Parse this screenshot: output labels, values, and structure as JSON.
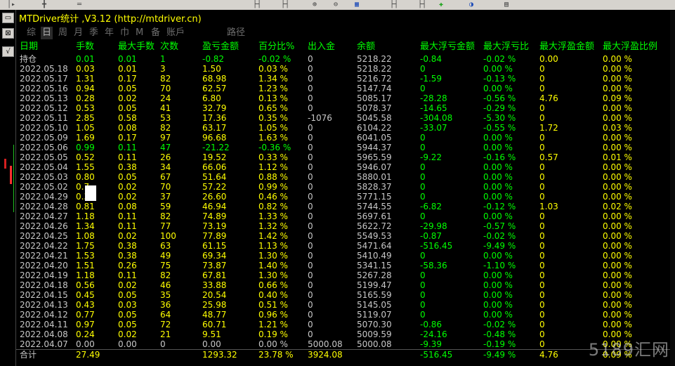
{
  "toolbar": {
    "icons": [
      "cursor-icon",
      "crosshair-icon",
      "hline-icon",
      "zoom-in-icon",
      "zoom-out-icon",
      "grid-icon",
      "period-icon",
      "chart-add-icon",
      "refresh-icon",
      "template-icon"
    ]
  },
  "left_strip": [
    "chart-icon",
    "collapse-icon",
    "check-icon"
  ],
  "window": {
    "title": "MTDriver统计 ,V3.12 (http://mtdriver.cn)"
  },
  "tabs": [
    "综",
    "日",
    "周",
    "月",
    "季",
    "年",
    "巾",
    "M",
    "备",
    "账戶",
    "路径"
  ],
  "active_tab": "日",
  "columns": [
    "日期",
    "手数",
    "最大手数",
    "次数",
    "盈亏金额",
    "百分比%",
    "出入金",
    "余额",
    "最大浮亏金额",
    "最大浮亏比",
    "最大浮盈金额",
    "最大浮盈比例"
  ],
  "rows": [
    {
      "date": "持仓",
      "lots": "0.01",
      "maxlots": "0.01",
      "count": "1",
      "pnl": "-0.82",
      "pct": "-0.02 %",
      "io": "0",
      "bal": "5218.22",
      "mfl": "-0.84",
      "mflr": "-0.02 %",
      "mfp": "0.00",
      "mfpr": "0.00 %",
      "tone": "green"
    },
    {
      "date": "2022.05.18",
      "lots": "0.03",
      "maxlots": "0.01",
      "count": "3",
      "pnl": "1.50",
      "pct": "0.03 %",
      "io": "0",
      "bal": "5218.22",
      "mfl": "0",
      "mflr": "0.00 %",
      "mfp": "0",
      "mfpr": "0.00 %",
      "tone": "yellow"
    },
    {
      "date": "2022.05.17",
      "lots": "1.31",
      "maxlots": "0.17",
      "count": "82",
      "pnl": "68.98",
      "pct": "1.34 %",
      "io": "0",
      "bal": "5216.72",
      "mfl": "-1.59",
      "mflr": "-0.13 %",
      "mfp": "0",
      "mfpr": "0.00 %",
      "tone": "yellow"
    },
    {
      "date": "2022.05.16",
      "lots": "0.94",
      "maxlots": "0.05",
      "count": "70",
      "pnl": "62.57",
      "pct": "1.23 %",
      "io": "0",
      "bal": "5147.74",
      "mfl": "0",
      "mflr": "0.00 %",
      "mfp": "0",
      "mfpr": "0.00 %",
      "tone": "yellow"
    },
    {
      "date": "2022.05.13",
      "lots": "0.28",
      "maxlots": "0.02",
      "count": "24",
      "pnl": "6.80",
      "pct": "0.13 %",
      "io": "0",
      "bal": "5085.17",
      "mfl": "-28.28",
      "mflr": "-0.56 %",
      "mfp": "4.76",
      "mfpr": "0.09 %",
      "tone": "yellow"
    },
    {
      "date": "2022.05.12",
      "lots": "0.53",
      "maxlots": "0.05",
      "count": "41",
      "pnl": "32.79",
      "pct": "0.65 %",
      "io": "0",
      "bal": "5078.37",
      "mfl": "-14.65",
      "mflr": "-0.29 %",
      "mfp": "0",
      "mfpr": "0.00 %",
      "tone": "yellow"
    },
    {
      "date": "2022.05.11",
      "lots": "2.85",
      "maxlots": "0.58",
      "count": "53",
      "pnl": "17.36",
      "pct": "0.35 %",
      "io": "-1076",
      "bal": "5045.58",
      "mfl": "-304.08",
      "mflr": "-5.30 %",
      "mfp": "0",
      "mfpr": "0.00 %",
      "tone": "yellow"
    },
    {
      "date": "2022.05.10",
      "lots": "1.05",
      "maxlots": "0.08",
      "count": "82",
      "pnl": "63.17",
      "pct": "1.05 %",
      "io": "0",
      "bal": "6104.22",
      "mfl": "-33.07",
      "mflr": "-0.55 %",
      "mfp": "1.72",
      "mfpr": "0.03 %",
      "tone": "yellow"
    },
    {
      "date": "2022.05.09",
      "lots": "1.69",
      "maxlots": "0.17",
      "count": "97",
      "pnl": "96.68",
      "pct": "1.63 %",
      "io": "0",
      "bal": "6041.05",
      "mfl": "0",
      "mflr": "0.00 %",
      "mfp": "0",
      "mfpr": "0.00 %",
      "tone": "yellow"
    },
    {
      "date": "2022.05.06",
      "lots": "0.99",
      "maxlots": "0.11",
      "count": "47",
      "pnl": "-21.22",
      "pct": "-0.36 %",
      "io": "0",
      "bal": "5944.37",
      "mfl": "0",
      "mflr": "0.00 %",
      "mfp": "0",
      "mfpr": "0.00 %",
      "tone": "green"
    },
    {
      "date": "2022.05.05",
      "lots": "0.52",
      "maxlots": "0.11",
      "count": "26",
      "pnl": "19.52",
      "pct": "0.33 %",
      "io": "0",
      "bal": "5965.59",
      "mfl": "-9.22",
      "mflr": "-0.16 %",
      "mfp": "0.57",
      "mfpr": "0.01 %",
      "tone": "yellow"
    },
    {
      "date": "2022.05.04",
      "lots": "1.55",
      "maxlots": "0.38",
      "count": "34",
      "pnl": "66.06",
      "pct": "1.12 %",
      "io": "0",
      "bal": "5946.07",
      "mfl": "0",
      "mflr": "0.00 %",
      "mfp": "0",
      "mfpr": "0.00 %",
      "tone": "yellow"
    },
    {
      "date": "2022.05.03",
      "lots": "0.80",
      "maxlots": "0.05",
      "count": "67",
      "pnl": "51.64",
      "pct": "0.88 %",
      "io": "0",
      "bal": "5880.01",
      "mfl": "0",
      "mflr": "0.00 %",
      "mfp": "0",
      "mfpr": "0.00 %",
      "tone": "yellow"
    },
    {
      "date": "2022.05.02",
      "lots": "0.7",
      "maxlots": "0.02",
      "count": "70",
      "pnl": "57.22",
      "pct": "0.99 %",
      "io": "0",
      "bal": "5828.37",
      "mfl": "0",
      "mflr": "0.00 %",
      "mfp": "0",
      "mfpr": "0.00 %",
      "tone": "yellow"
    },
    {
      "date": "2022.04.29",
      "lots": "0.3",
      "maxlots": "0.02",
      "count": "37",
      "pnl": "26.60",
      "pct": "0.46 %",
      "io": "0",
      "bal": "5771.15",
      "mfl": "0",
      "mflr": "0.00 %",
      "mfp": "0",
      "mfpr": "0.00 %",
      "tone": "yellow"
    },
    {
      "date": "2022.04.28",
      "lots": "0.81",
      "maxlots": "0.08",
      "count": "59",
      "pnl": "46.94",
      "pct": "0.82 %",
      "io": "0",
      "bal": "5744.55",
      "mfl": "-6.82",
      "mflr": "-0.12 %",
      "mfp": "1.03",
      "mfpr": "0.02 %",
      "tone": "yellow"
    },
    {
      "date": "2022.04.27",
      "lots": "1.18",
      "maxlots": "0.11",
      "count": "82",
      "pnl": "74.89",
      "pct": "1.33 %",
      "io": "0",
      "bal": "5697.61",
      "mfl": "0",
      "mflr": "0.00 %",
      "mfp": "0",
      "mfpr": "0.00 %",
      "tone": "yellow"
    },
    {
      "date": "2022.04.26",
      "lots": "1.34",
      "maxlots": "0.11",
      "count": "77",
      "pnl": "73.19",
      "pct": "1.32 %",
      "io": "0",
      "bal": "5622.72",
      "mfl": "-29.98",
      "mflr": "-0.57 %",
      "mfp": "0",
      "mfpr": "0.00 %",
      "tone": "yellow"
    },
    {
      "date": "2022.04.25",
      "lots": "1.08",
      "maxlots": "0.02",
      "count": "100",
      "pnl": "77.89",
      "pct": "1.42 %",
      "io": "0",
      "bal": "5549.53",
      "mfl": "-0.87",
      "mflr": "-0.02 %",
      "mfp": "0",
      "mfpr": "0.00 %",
      "tone": "yellow"
    },
    {
      "date": "2022.04.22",
      "lots": "1.75",
      "maxlots": "0.38",
      "count": "63",
      "pnl": "61.15",
      "pct": "1.13 %",
      "io": "0",
      "bal": "5471.64",
      "mfl": "-516.45",
      "mflr": "-9.49 %",
      "mfp": "0",
      "mfpr": "0.00 %",
      "tone": "yellow"
    },
    {
      "date": "2022.04.21",
      "lots": "1.53",
      "maxlots": "0.38",
      "count": "49",
      "pnl": "69.34",
      "pct": "1.30 %",
      "io": "0",
      "bal": "5410.49",
      "mfl": "0",
      "mflr": "0.00 %",
      "mfp": "0",
      "mfpr": "0.00 %",
      "tone": "yellow"
    },
    {
      "date": "2022.04.20",
      "lots": "1.51",
      "maxlots": "0.26",
      "count": "75",
      "pnl": "73.87",
      "pct": "1.40 %",
      "io": "0",
      "bal": "5341.15",
      "mfl": "-58.36",
      "mflr": "-1.10 %",
      "mfp": "0",
      "mfpr": "0.00 %",
      "tone": "yellow"
    },
    {
      "date": "2022.04.19",
      "lots": "1.18",
      "maxlots": "0.11",
      "count": "82",
      "pnl": "67.81",
      "pct": "1.30 %",
      "io": "0",
      "bal": "5267.28",
      "mfl": "0",
      "mflr": "0.00 %",
      "mfp": "0",
      "mfpr": "0.00 %",
      "tone": "yellow"
    },
    {
      "date": "2022.04.18",
      "lots": "0.56",
      "maxlots": "0.02",
      "count": "46",
      "pnl": "33.88",
      "pct": "0.66 %",
      "io": "0",
      "bal": "5199.47",
      "mfl": "0",
      "mflr": "0.00 %",
      "mfp": "0",
      "mfpr": "0.00 %",
      "tone": "yellow"
    },
    {
      "date": "2022.04.15",
      "lots": "0.45",
      "maxlots": "0.05",
      "count": "35",
      "pnl": "20.54",
      "pct": "0.40 %",
      "io": "0",
      "bal": "5165.59",
      "mfl": "0",
      "mflr": "0.00 %",
      "mfp": "0",
      "mfpr": "0.00 %",
      "tone": "yellow"
    },
    {
      "date": "2022.04.13",
      "lots": "0.43",
      "maxlots": "0.03",
      "count": "36",
      "pnl": "25.98",
      "pct": "0.51 %",
      "io": "0",
      "bal": "5145.05",
      "mfl": "0",
      "mflr": "0.00 %",
      "mfp": "0",
      "mfpr": "0.00 %",
      "tone": "yellow"
    },
    {
      "date": "2022.04.12",
      "lots": "0.77",
      "maxlots": "0.05",
      "count": "64",
      "pnl": "48.77",
      "pct": "0.96 %",
      "io": "0",
      "bal": "5119.07",
      "mfl": "0",
      "mflr": "0.00 %",
      "mfp": "0",
      "mfpr": "0.00 %",
      "tone": "yellow"
    },
    {
      "date": "2022.04.11",
      "lots": "0.97",
      "maxlots": "0.05",
      "count": "72",
      "pnl": "60.71",
      "pct": "1.21 %",
      "io": "0",
      "bal": "5070.30",
      "mfl": "-0.86",
      "mflr": "-0.02 %",
      "mfp": "0",
      "mfpr": "0.00 %",
      "tone": "yellow"
    },
    {
      "date": "2022.04.08",
      "lots": "0.24",
      "maxlots": "0.02",
      "count": "21",
      "pnl": "9.51",
      "pct": "0.19 %",
      "io": "0",
      "bal": "5009.59",
      "mfl": "-24.16",
      "mflr": "-0.48 %",
      "mfp": "0",
      "mfpr": "0.00 %",
      "tone": "yellow"
    },
    {
      "date": "2022.04.07",
      "lots": "0.00",
      "maxlots": "0.00",
      "count": "0",
      "pnl": "0.00",
      "pct": "0.00 %",
      "io": "5000.08",
      "bal": "5000.08",
      "mfl": "-9.39",
      "mflr": "-0.19 %",
      "mfp": "0",
      "mfpr": "0.00 %",
      "tone": "grey"
    }
  ],
  "total": {
    "date": "合计",
    "lots": "27.49",
    "maxlots": "",
    "count": "",
    "pnl": "1293.32",
    "pct": "23.78 %",
    "io": "3924.08",
    "bal": "",
    "mfl": "-516.45",
    "mflr": "-9.49 %",
    "mfp": "4.76",
    "mfpr": "0.09 %"
  },
  "watermark": "5189汇网",
  "colors": {
    "header": "#00ff00",
    "positive": "#ffff00",
    "negative": "#00ff00",
    "neutral": "#c8c8c8",
    "background": "#000000"
  }
}
